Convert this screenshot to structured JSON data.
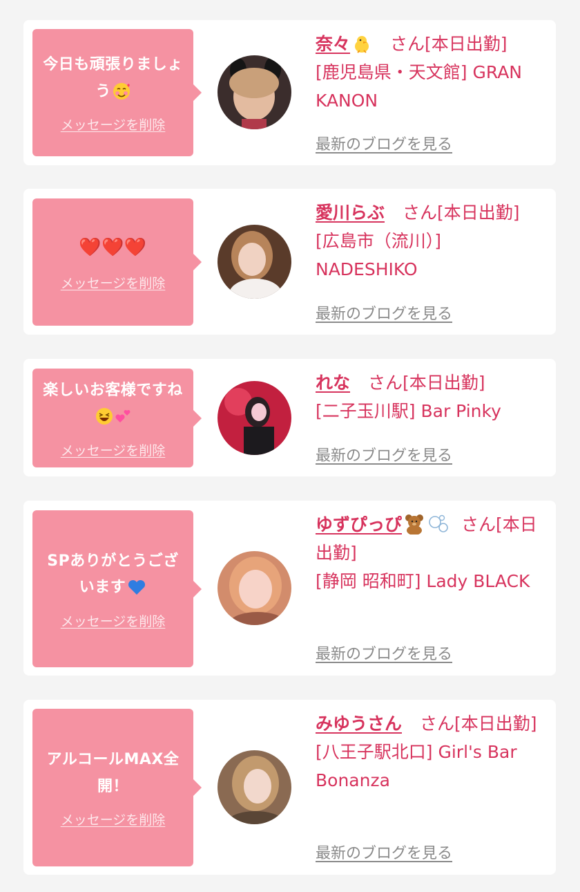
{
  "messages": [
    {
      "message": "今日も頑張りましょう",
      "message_emoji": "smiling-face-with-hearts",
      "delete_label": "メッセージを削除",
      "name": "奈々",
      "name_emoji": "baby-chick",
      "honorific": "さん",
      "status": "[本日出勤]",
      "location": "[鹿児島県・天文館]",
      "shop": "GRAN KANON",
      "blog_label": "最新のブログを見る"
    },
    {
      "message": "❤️❤️❤️",
      "delete_label": "メッセージを削除",
      "name": "愛川らぶ",
      "honorific": "さん",
      "status": "[本日出勤]",
      "location": "[広島市（流川）]",
      "shop": "NADESHIKO",
      "blog_label": "最新のブログを見る"
    },
    {
      "message": "楽しいお客様ですね",
      "message_emoji": "grinning-squinting-face, two-hearts",
      "delete_label": "メッセージを削除",
      "name": "れな",
      "honorific": "さん",
      "status": "[本日出勤]",
      "location": "[二子玉川駅]",
      "shop": "Bar Pinky",
      "blog_label": "最新のブログを見る"
    },
    {
      "message": "SPありがとうございます",
      "message_emoji": "blue-heart",
      "delete_label": "メッセージを削除",
      "name": "ゆずぴっぴ",
      "name_emoji": "teddy-bear, bubbles",
      "honorific": "さん",
      "status": "[本日出勤]",
      "location": "[静岡 昭和町]",
      "shop": "Lady BLACK",
      "blog_label": "最新のブログを見る"
    },
    {
      "message": "アルコールMAX全開！",
      "delete_label": "メッセージを削除",
      "name": "みゆうさん",
      "honorific": "さん",
      "status": "[本日出勤]",
      "location": "[八王子駅北口]",
      "shop": "Girl's Bar Bonanza",
      "blog_label": "最新のブログを見る"
    }
  ],
  "colors": {
    "background": "#f4f4f4",
    "card": "#ffffff",
    "bubble": "#f592a2",
    "accent_text": "#d7335d",
    "link_gray": "#8a8a8a"
  }
}
